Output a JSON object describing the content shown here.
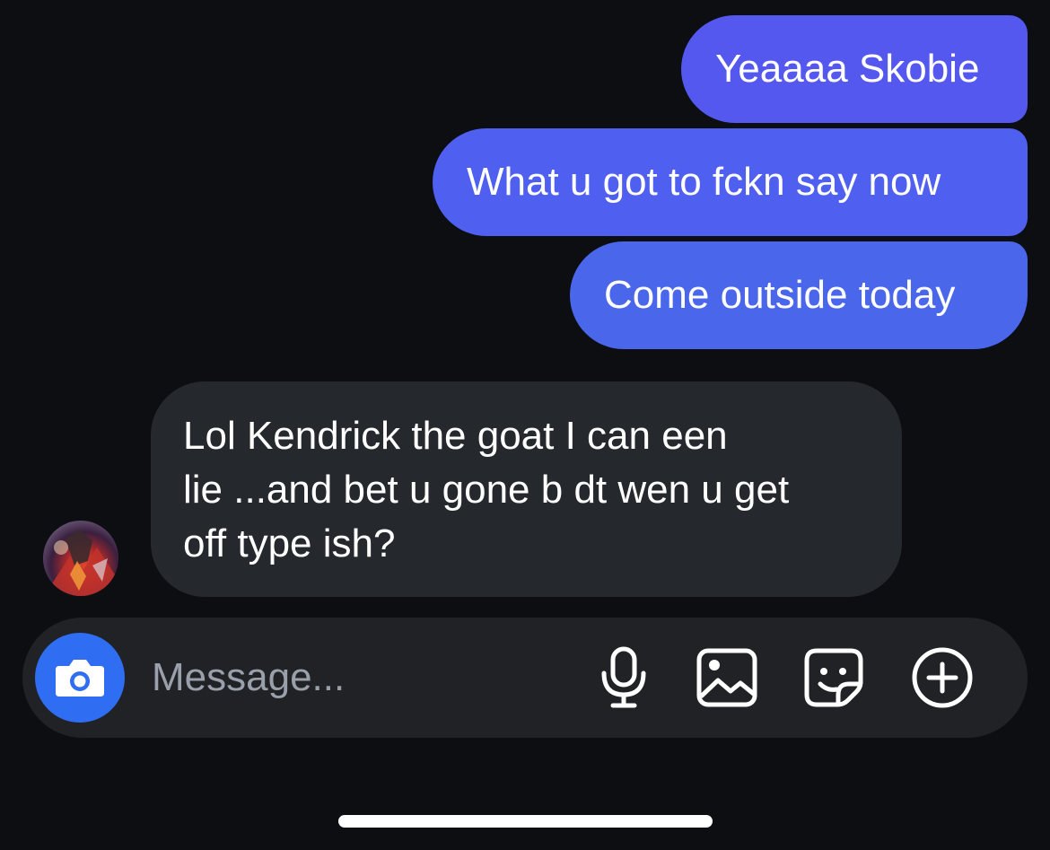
{
  "thread": {
    "sent_messages": [
      "Yeaaaa Skobie",
      "What u got to fckn say now",
      "Come outside today"
    ],
    "received_message": {
      "lines": [
        "Lol Kendrick the goat I can een",
        "lie ...and bet u gone b dt wen u get",
        "off type ish?"
      ]
    }
  },
  "composer": {
    "placeholder": "Message...",
    "value": "",
    "icons": [
      "camera-icon",
      "microphone-icon",
      "gallery-icon",
      "sticker-icon",
      "plus-circle-icon"
    ]
  },
  "colors": {
    "background": "#0c0e12",
    "sent_bubble_top": "#5558ee",
    "sent_bubble_bottom": "#4a67ec",
    "received_bubble": "#25282d",
    "composer": "#202226",
    "camera_button": "#2f6ef2"
  }
}
